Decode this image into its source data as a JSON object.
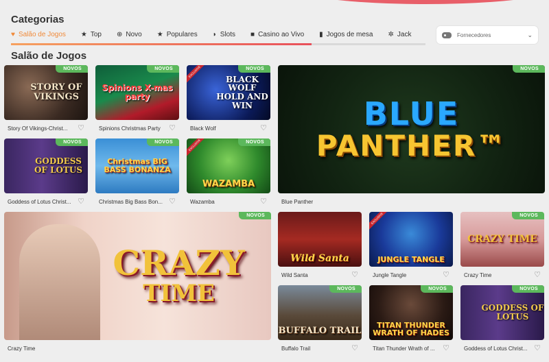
{
  "header": {
    "categories_title": "Categorias",
    "section_title": "Salão de Jogos",
    "tabs": [
      {
        "label": "Salão de Jogos",
        "icon": "heart-icon"
      },
      {
        "label": "Top",
        "icon": "star-icon"
      },
      {
        "label": "Novo",
        "icon": "plus-circle-icon"
      },
      {
        "label": "Populares",
        "icon": "star-icon"
      },
      {
        "label": "Slots",
        "icon": "slot-icon"
      },
      {
        "label": "Casino ao Vivo",
        "icon": "camera-icon"
      },
      {
        "label": "Jogos de mesa",
        "icon": "card-icon"
      },
      {
        "label": "Jack",
        "icon": "gear-icon"
      }
    ],
    "provider_placeholder": "Fornecedores"
  },
  "badge_label": "NOVOS",
  "exclusive_label": "EXCLUSIVE",
  "games": [
    {
      "name": "Story Of Vikings-Christ...",
      "art": "STORY OF VIKINGS",
      "new": true
    },
    {
      "name": "Spinions Christmas Party",
      "art": "Spinions X-mas party",
      "new": true
    },
    {
      "name": "Black Wolf",
      "art": "BLACK WOLF HOLD AND WIN",
      "new": true
    },
    {
      "name": "Blue Panther",
      "art1": "BLUE",
      "art2": "PANTHER™",
      "new": true
    },
    {
      "name": "Goddess of Lotus Christ...",
      "art": "GODDESS OF LOTUS",
      "new": true
    },
    {
      "name": "Christmas Big Bass Bon...",
      "art": "Christmas BIG BASS BONANZA",
      "new": true
    },
    {
      "name": "Wazamba",
      "art": "WAZAMBA",
      "new": true
    },
    {
      "name": "Crazy Time",
      "art1": "CRAZY",
      "art2": "TIME",
      "new": true
    },
    {
      "name": "Wild Santa",
      "art": "Wild Santa",
      "new": false
    },
    {
      "name": "Jungle Tangle",
      "art": "JUNGLE TANGLE",
      "new": false
    },
    {
      "name": "Crazy Time",
      "art": "CRAZY TIME",
      "new": true
    },
    {
      "name": "Buffalo Trail",
      "art": "BUFFALO TRAIL",
      "new": true
    },
    {
      "name": "Titan Thunder Wrath of ...",
      "art": "TITAN THUNDER WRATH OF HADES",
      "new": true
    },
    {
      "name": "Goddess of Lotus Christ...",
      "art": "GODDESS OF LOTUS",
      "new": true
    }
  ],
  "colors": {
    "accent": "#f08a3a",
    "badge": "#5cb85c",
    "exclusive": "#c9262e"
  }
}
